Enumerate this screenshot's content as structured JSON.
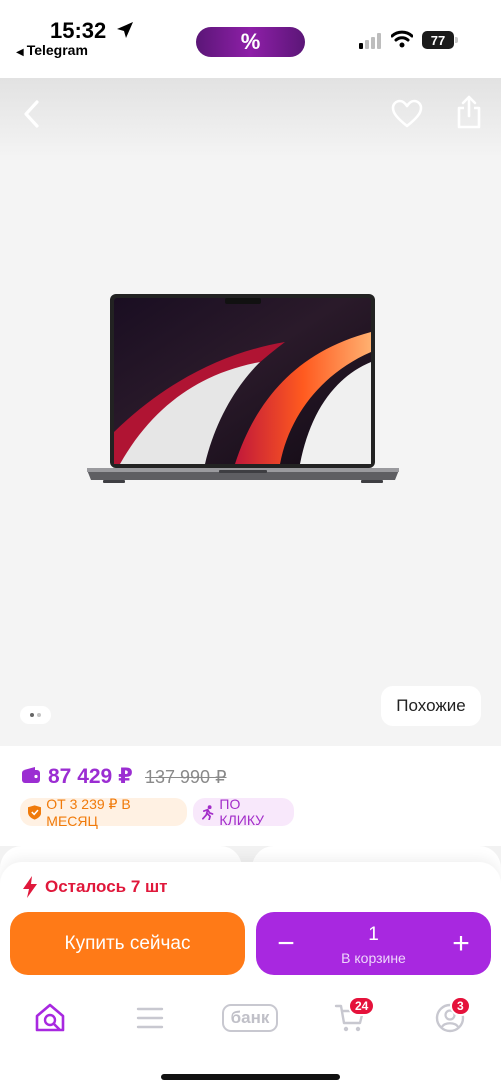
{
  "status_bar": {
    "time": "15:32",
    "back_app": "Telegram",
    "promo_symbol": "%",
    "battery": "77"
  },
  "hero": {
    "image_count": 2,
    "active_image": 1,
    "similar_label": "Похожие",
    "icons": {
      "back": "chevron-left-icon",
      "favorite": "heart-icon",
      "share": "share-icon"
    }
  },
  "price": {
    "current": "87 429 ₽",
    "old": "137 990 ₽",
    "installment": "ОТ 3 239 ₽ В МЕСЯЦ",
    "one_click": "ПО КЛИКУ"
  },
  "sheet": {
    "remaining": "Осталось 7 шт",
    "buy_now": "Купить сейчас",
    "quantity": "1",
    "in_cart": "В корзине",
    "minus": "−",
    "plus": "+"
  },
  "tabbar": {
    "bank_label": "банк",
    "cart_badge": "24",
    "profile_badge": "3"
  },
  "colors": {
    "accent": "#a828e0",
    "price": "#9b2dd2",
    "buy": "#ff7a17",
    "alert": "#e0183b"
  }
}
